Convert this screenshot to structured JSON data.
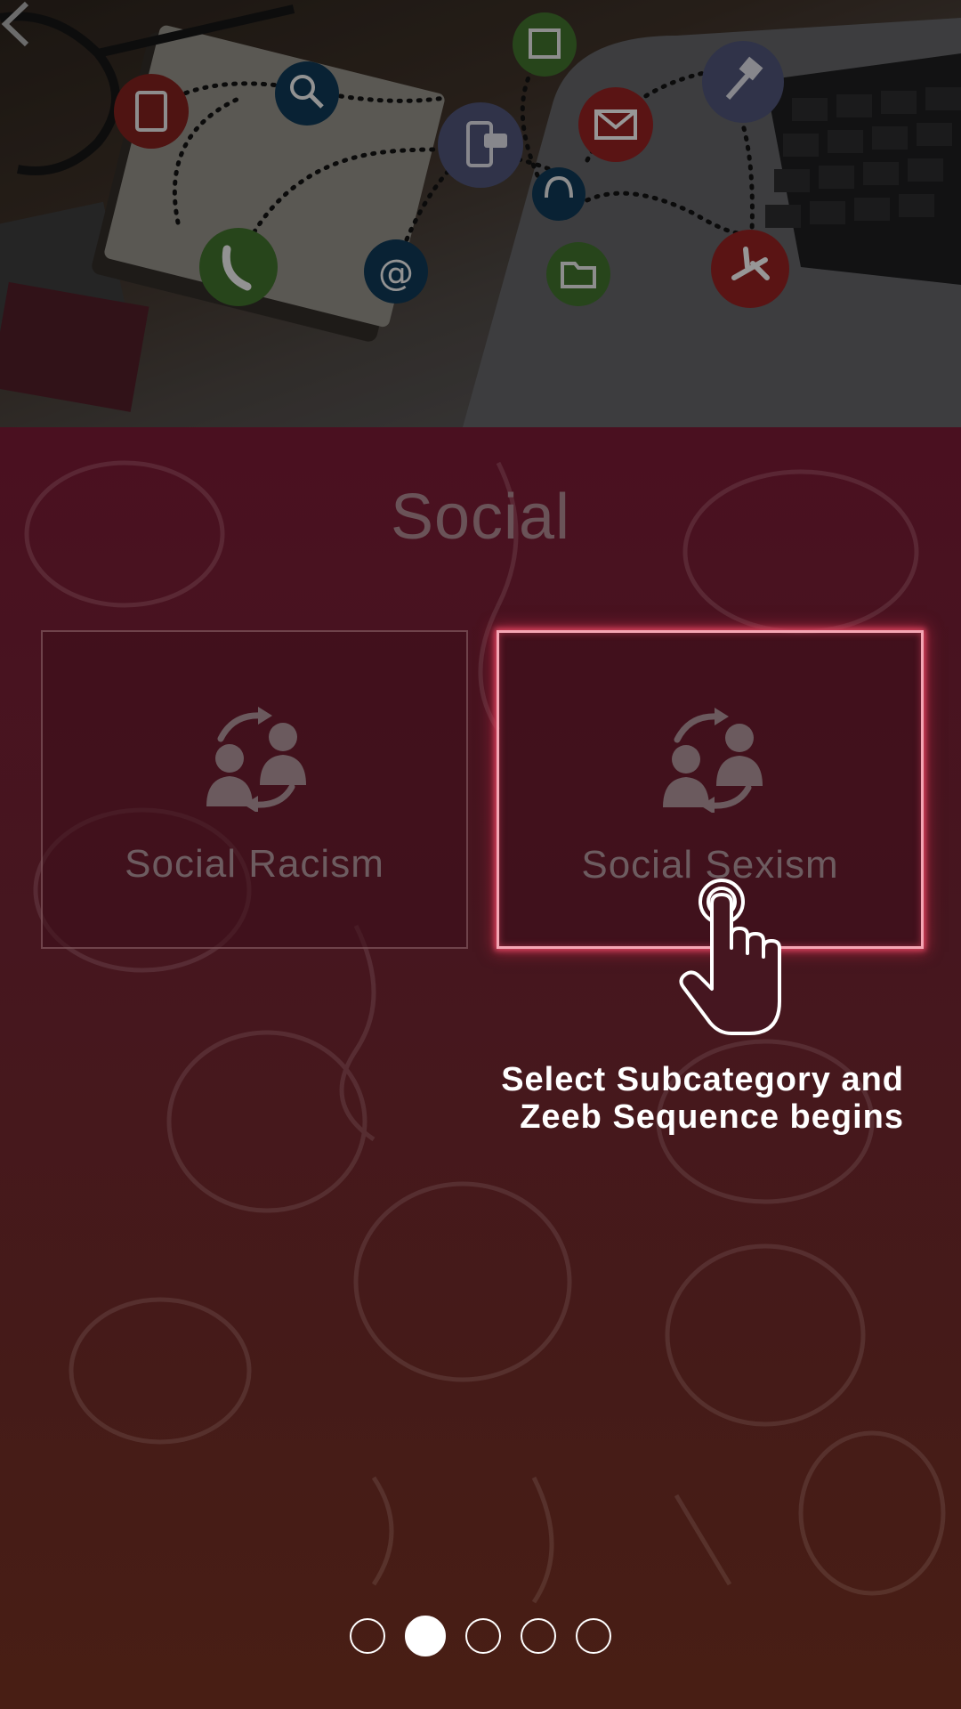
{
  "hero": {
    "description_icons": [
      "notebook-icon",
      "search-icon",
      "calendar-icon",
      "chat-icon",
      "mail-icon",
      "headset-icon",
      "pushpin-icon",
      "phone-icon",
      "at-sign-icon",
      "folder-icon",
      "airplane-icon"
    ]
  },
  "page": {
    "title": "Social"
  },
  "subcategories": [
    {
      "label": "Social Racism",
      "icon": "people-exchange-icon"
    },
    {
      "label": "Social Sexism",
      "icon": "people-exchange-icon",
      "highlighted": true
    }
  ],
  "tutorial": {
    "hint_line1": "Select Subcategory and",
    "hint_line2": "Zeeb Sequence begins"
  },
  "pager": {
    "count": 5,
    "active_index": 1
  },
  "colors": {
    "highlight": "#d9445f",
    "panel_top": "#4a1020",
    "panel_bottom": "#481e14"
  }
}
